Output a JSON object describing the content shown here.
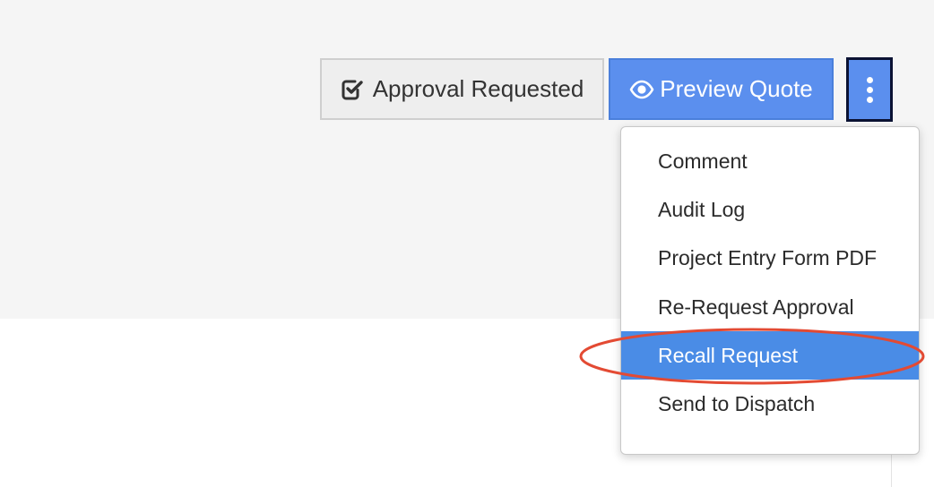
{
  "toolbar": {
    "approval_label": "Approval Requested",
    "approval_icon": "checkbox-check-icon",
    "preview_label": "Preview Quote",
    "preview_icon": "eye-icon",
    "more_icon": "vertical-ellipsis-icon"
  },
  "menu": {
    "items": [
      {
        "label": "Comment"
      },
      {
        "label": "Audit Log"
      },
      {
        "label": "Project Entry Form PDF"
      },
      {
        "label": "Re-Request Approval"
      },
      {
        "label": "Recall Request",
        "highlighted": true
      },
      {
        "label": "Send to Dispatch"
      }
    ]
  },
  "colors": {
    "accent": "#5b8fee",
    "highlight": "#4a8ce6",
    "annotation": "#e34a33"
  }
}
